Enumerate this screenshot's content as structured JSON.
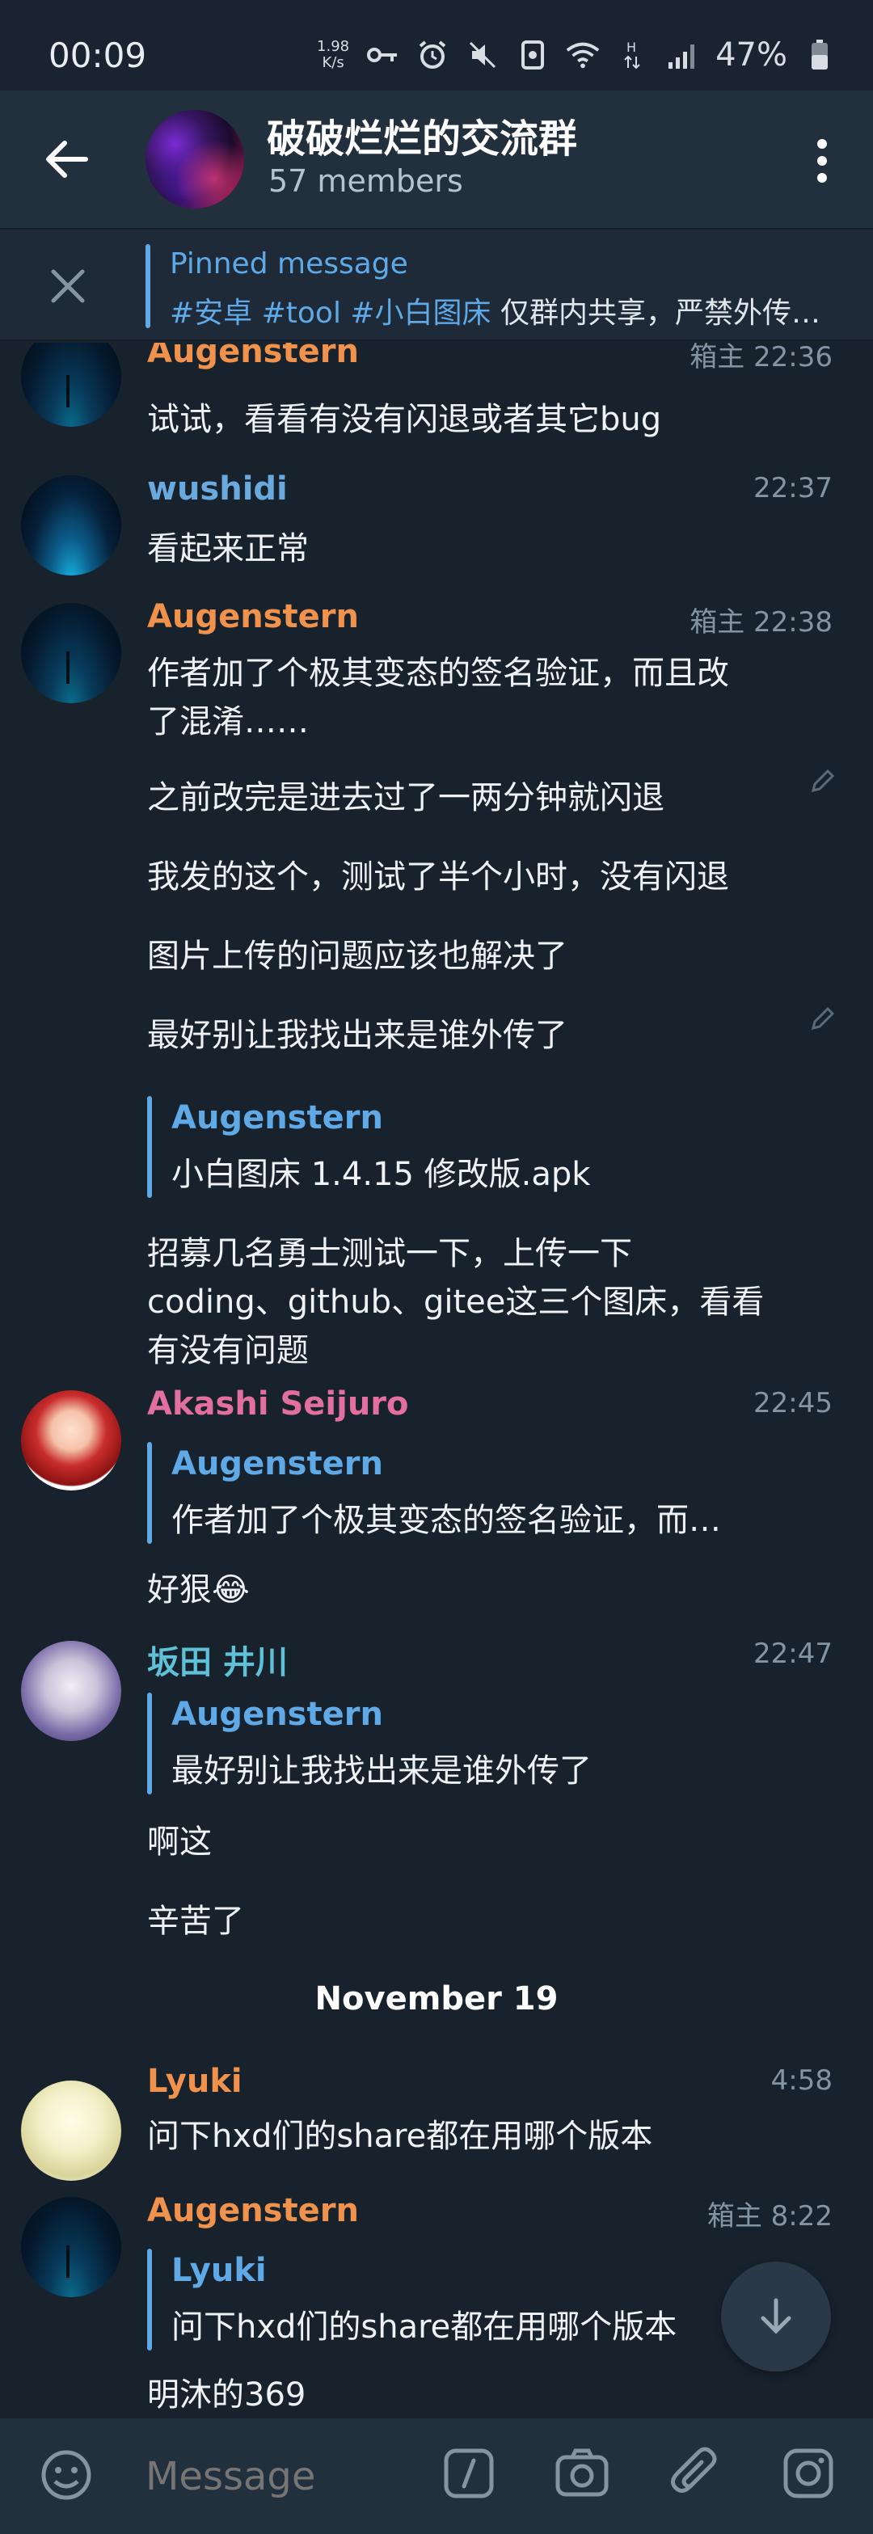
{
  "status_bar": {
    "time": "00:09",
    "net_speed": "1.98\nK/s",
    "battery": "47%"
  },
  "header": {
    "title": "破破烂烂的交流群",
    "members": "57 members"
  },
  "pinned": {
    "label": "Pinned message",
    "tags": "#安卓 #tool #小白图床",
    "text": " 仅群内共享，严禁外传…"
  },
  "messages": [
    {
      "sender": "Augenstern",
      "meta": "箱主 22:36",
      "lines": [
        "试试，看看有没有闪退或者其它bug"
      ]
    },
    {
      "sender": "wushidi",
      "meta": "22:37",
      "lines": [
        "看起来正常"
      ]
    },
    {
      "sender": "Augenstern",
      "meta": "箱主 22:38",
      "lines": [
        "作者加了个极其变态的签名验证，而且改",
        "了混淆……",
        "之前改完是进去过了一两分钟就闪退",
        "我发的这个，测试了半个小时，没有闪退",
        "图片上传的问题应该也解决了",
        "最好别让我找出来是谁外传了"
      ],
      "quote": {
        "name": "Augenstern",
        "text": "小白图床 1.4.15 修改版.apk"
      },
      "after_quote": [
        "招募几名勇士测试一下，上传一下",
        "coding、github、gitee这三个图床，看看",
        "有没有问题"
      ]
    },
    {
      "sender": "Akashi Seijuro",
      "meta": "22:45",
      "quote": {
        "name": "Augenstern",
        "text": "作者加了个极其变态的签名验证，而…"
      },
      "lines": [
        "好狠😂"
      ]
    },
    {
      "sender": "坂田 井川",
      "meta": "22:47",
      "quote": {
        "name": "Augenstern",
        "text": "最好别让我找出来是谁外传了"
      },
      "lines": [
        "啊这",
        "辛苦了"
      ]
    },
    {
      "date": "November 19"
    },
    {
      "sender": "Lyuki",
      "meta": "4:58",
      "lines": [
        "问下hxd们的share都在用哪个版本"
      ]
    },
    {
      "sender": "Augenstern",
      "meta": "箱主 8:22",
      "quote": {
        "name": "Lyuki",
        "text": "问下hxd们的share都在用哪个版本"
      },
      "lines": [
        "明沐的369"
      ]
    }
  ],
  "input": {
    "placeholder": "Message"
  },
  "icons": {
    "back": "arrow-left-icon",
    "more": "more-vertical-icon",
    "close": "close-icon",
    "emoji": "emoji-icon",
    "command": "slash-command-icon",
    "camera": "camera-icon",
    "attach": "paperclip-icon",
    "instagram": "instagram-icon",
    "scroll_down": "arrow-down-icon"
  },
  "colors": {
    "background": "#18222d",
    "header": "#222f3d",
    "accent": "#5ea9e6"
  }
}
